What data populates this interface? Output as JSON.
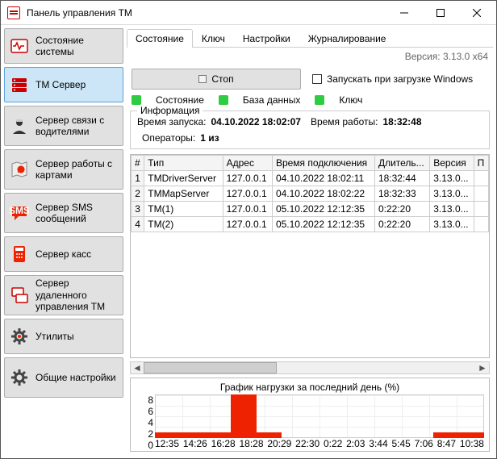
{
  "window": {
    "title": "Панель управления TM"
  },
  "sidebar": {
    "items": [
      {
        "label": "Состояние системы"
      },
      {
        "label": "ТМ Сервер",
        "selected": true
      },
      {
        "label": "Сервер связи с водителями"
      },
      {
        "label": "Сервер работы с картами"
      },
      {
        "label": "Сервер SMS сообщений"
      },
      {
        "label": "Сервер касс"
      },
      {
        "label": "Сервер удаленного управления TM"
      },
      {
        "label": "Утилиты"
      },
      {
        "label": "Общие настройки"
      }
    ]
  },
  "tabs": [
    {
      "label": "Состояние",
      "active": true
    },
    {
      "label": "Ключ"
    },
    {
      "label": "Настройки"
    },
    {
      "label": "Журналирование"
    }
  ],
  "version_label": "Версия: 3.13.0 x64",
  "stop_label": "Стоп",
  "autostart_label": "Запускать при загрузке Windows",
  "status_labels": {
    "state": "Состояние",
    "db": "База данных",
    "key": "Ключ"
  },
  "info": {
    "legend": "Информация",
    "launch_label": "Время запуска:",
    "launch_value": "04.10.2022 18:02:07",
    "uptime_label": "Время работы:",
    "uptime_value": "18:32:48",
    "operators_label": "Операторы:",
    "operators_value": "1 из"
  },
  "columns": [
    "#",
    "Тип",
    "Адрес",
    "Время подключения",
    "Длитель...",
    "Версия",
    "П"
  ],
  "rows": [
    {
      "n": "1",
      "type": "TMDriverServer",
      "addr": "127.0.0.1",
      "conn": "04.10.2022 18:02:11",
      "dur": "18:32:44",
      "ver": "3.13.0..."
    },
    {
      "n": "2",
      "type": "TMMapServer",
      "addr": "127.0.0.1",
      "conn": "04.10.2022 18:02:22",
      "dur": "18:32:33",
      "ver": "3.13.0..."
    },
    {
      "n": "3",
      "type": "TM(1)",
      "addr": "127.0.0.1",
      "conn": "05.10.2022 12:12:35",
      "dur": "0:22:20",
      "ver": "3.13.0..."
    },
    {
      "n": "4",
      "type": "TM(2)",
      "addr": "127.0.0.1",
      "conn": "05.10.2022 12:12:35",
      "dur": "0:22:20",
      "ver": "3.13.0..."
    }
  ],
  "chart_data": {
    "type": "bar",
    "title": "График нагрузки за последний день (%)",
    "ylabel": "%",
    "ylim": [
      0,
      8
    ],
    "yticks": [
      0,
      2,
      4,
      6,
      8
    ],
    "categories": [
      "12:35",
      "14:26",
      "16:28",
      "18:28",
      "20:29",
      "22:30",
      "0:22",
      "2:03",
      "3:44",
      "5:45",
      "7:06",
      "8:47",
      "10:38"
    ],
    "values": [
      1,
      1,
      1,
      8,
      1,
      0,
      0,
      0,
      0,
      0,
      0,
      1,
      1
    ]
  }
}
